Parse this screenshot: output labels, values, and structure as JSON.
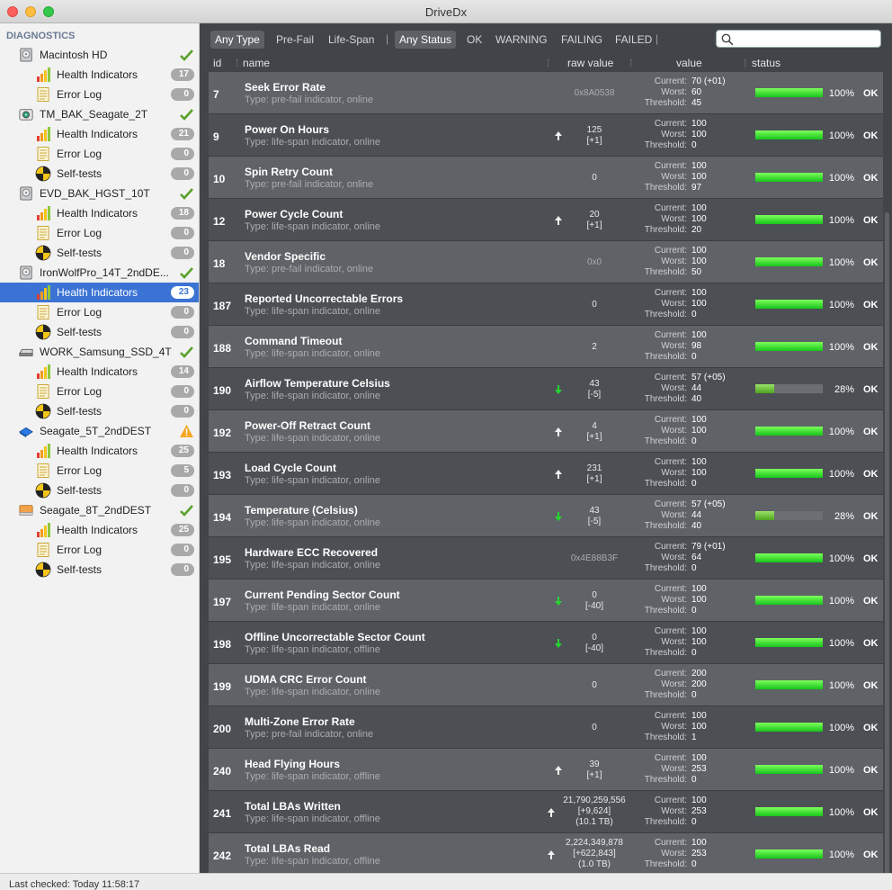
{
  "window": {
    "title": "DriveDx"
  },
  "sidebar": {
    "title": "DIAGNOSTICS",
    "drives": [
      {
        "name": "Macintosh HD",
        "icon": "hdd-icon",
        "status": "ok",
        "items": [
          {
            "label": "Health Indicators",
            "count": "17",
            "icon": "bar-chart-icon"
          },
          {
            "label": "Error Log",
            "count": "0",
            "icon": "log-icon"
          }
        ]
      },
      {
        "name": "TM_BAK_Seagate_2T",
        "icon": "external-drive-icon",
        "status": "ok",
        "items": [
          {
            "label": "Health Indicators",
            "count": "21",
            "icon": "bar-chart-icon"
          },
          {
            "label": "Error Log",
            "count": "0",
            "icon": "log-icon"
          },
          {
            "label": "Self-tests",
            "count": "0",
            "icon": "selftest-icon"
          }
        ]
      },
      {
        "name": "EVD_BAK_HGST_10T",
        "icon": "hdd-icon",
        "status": "ok",
        "items": [
          {
            "label": "Health Indicators",
            "count": "18",
            "icon": "bar-chart-icon"
          },
          {
            "label": "Error Log",
            "count": "0",
            "icon": "log-icon"
          },
          {
            "label": "Self-tests",
            "count": "0",
            "icon": "selftest-icon"
          }
        ]
      },
      {
        "name": "IronWolfPro_14T_2ndDE...",
        "icon": "hdd-icon",
        "status": "ok",
        "items": [
          {
            "label": "Health Indicators",
            "count": "23",
            "icon": "bar-chart-icon",
            "selected": true
          },
          {
            "label": "Error Log",
            "count": "0",
            "icon": "log-icon"
          },
          {
            "label": "Self-tests",
            "count": "0",
            "icon": "selftest-icon"
          }
        ]
      },
      {
        "name": "WORK_Samsung_SSD_4T",
        "icon": "ssd-icon",
        "status": "ok",
        "items": [
          {
            "label": "Health Indicators",
            "count": "14",
            "icon": "bar-chart-icon"
          },
          {
            "label": "Error Log",
            "count": "0",
            "icon": "log-icon"
          },
          {
            "label": "Self-tests",
            "count": "0",
            "icon": "selftest-icon"
          }
        ]
      },
      {
        "name": "Seagate_5T_2ndDEST",
        "icon": "blue-drive-icon",
        "status": "warning",
        "items": [
          {
            "label": "Health Indicators",
            "count": "25",
            "icon": "bar-chart-icon"
          },
          {
            "label": "Error Log",
            "count": "5",
            "icon": "log-icon"
          },
          {
            "label": "Self-tests",
            "count": "0",
            "icon": "selftest-icon"
          }
        ]
      },
      {
        "name": "Seagate_8T_2ndDEST",
        "icon": "orange-drive-icon",
        "status": "ok",
        "items": [
          {
            "label": "Health Indicators",
            "count": "25",
            "icon": "bar-chart-icon"
          },
          {
            "label": "Error Log",
            "count": "0",
            "icon": "log-icon"
          },
          {
            "label": "Self-tests",
            "count": "0",
            "icon": "selftest-icon"
          }
        ]
      }
    ]
  },
  "filters": {
    "type": [
      {
        "label": "Any Type",
        "active": true
      },
      {
        "label": "Pre-Fail",
        "active": false
      },
      {
        "label": "Life-Span",
        "active": false
      }
    ],
    "status": [
      {
        "label": "Any Status",
        "active": true
      },
      {
        "label": "OK",
        "active": false
      },
      {
        "label": "WARNING",
        "active": false
      },
      {
        "label": "FAILING",
        "active": false
      },
      {
        "label": "FAILED",
        "active": false
      }
    ],
    "separator": "|",
    "search": {
      "value": "",
      "placeholder": ""
    }
  },
  "table": {
    "columns": {
      "id": "id",
      "name": "name",
      "raw": "raw value",
      "value": "value",
      "status": "status"
    },
    "labels": {
      "current": "Current:",
      "worst": "Worst:",
      "threshold": "Threshold:"
    },
    "rows": [
      {
        "id": "7",
        "name": "Seek Error Rate",
        "type": "Type: pre-fail indicator, online",
        "raw": [
          "0x8A0538"
        ],
        "hex": true,
        "trend": "none",
        "current": "70 (+01)",
        "worst": "60",
        "threshold": "45",
        "pct": 100,
        "pct_label": "100%",
        "status": "OK"
      },
      {
        "id": "9",
        "name": "Power On Hours",
        "type": "Type: life-span indicator, online",
        "raw": [
          "125",
          "[+1]"
        ],
        "trend": "up",
        "current": "100",
        "worst": "100",
        "threshold": "0",
        "pct": 100,
        "pct_label": "100%",
        "status": "OK"
      },
      {
        "id": "10",
        "name": "Spin Retry Count",
        "type": "Type: pre-fail indicator, online",
        "raw": [
          "0"
        ],
        "trend": "none",
        "current": "100",
        "worst": "100",
        "threshold": "97",
        "pct": 100,
        "pct_label": "100%",
        "status": "OK"
      },
      {
        "id": "12",
        "name": "Power Cycle Count",
        "type": "Type: life-span indicator, online",
        "raw": [
          "20",
          "[+1]"
        ],
        "trend": "up",
        "current": "100",
        "worst": "100",
        "threshold": "20",
        "pct": 100,
        "pct_label": "100%",
        "status": "OK"
      },
      {
        "id": "18",
        "name": "Vendor Specific",
        "type": "Type: pre-fail indicator, online",
        "raw": [
          "0x0"
        ],
        "hex": true,
        "trend": "none",
        "current": "100",
        "worst": "100",
        "threshold": "50",
        "pct": 100,
        "pct_label": "100%",
        "status": "OK"
      },
      {
        "id": "187",
        "name": "Reported Uncorrectable Errors",
        "type": "Type: life-span indicator, online",
        "raw": [
          "0"
        ],
        "trend": "none",
        "current": "100",
        "worst": "100",
        "threshold": "0",
        "pct": 100,
        "pct_label": "100%",
        "status": "OK"
      },
      {
        "id": "188",
        "name": "Command Timeout",
        "type": "Type: life-span indicator, online",
        "raw": [
          "2"
        ],
        "trend": "none",
        "current": "100",
        "worst": "98",
        "threshold": "0",
        "pct": 100,
        "pct_label": "100%",
        "status": "OK"
      },
      {
        "id": "190",
        "name": "Airflow Temperature Celsius",
        "type": "Type: life-span indicator, online",
        "raw": [
          "43",
          "[-5]"
        ],
        "trend": "down",
        "current": "57 (+05)",
        "worst": "44",
        "threshold": "40",
        "pct": 28,
        "pct_label": "28%",
        "status": "OK"
      },
      {
        "id": "192",
        "name": "Power-Off Retract Count",
        "type": "Type: life-span indicator, online",
        "raw": [
          "4",
          "[+1]"
        ],
        "trend": "up",
        "current": "100",
        "worst": "100",
        "threshold": "0",
        "pct": 100,
        "pct_label": "100%",
        "status": "OK"
      },
      {
        "id": "193",
        "name": "Load Cycle Count",
        "type": "Type: life-span indicator, online",
        "raw": [
          "231",
          "[+1]"
        ],
        "trend": "up",
        "current": "100",
        "worst": "100",
        "threshold": "0",
        "pct": 100,
        "pct_label": "100%",
        "status": "OK"
      },
      {
        "id": "194",
        "name": "Temperature (Celsius)",
        "type": "Type: life-span indicator, online",
        "raw": [
          "43",
          "[-5]"
        ],
        "trend": "down",
        "current": "57 (+05)",
        "worst": "44",
        "threshold": "40",
        "pct": 28,
        "pct_label": "28%",
        "status": "OK"
      },
      {
        "id": "195",
        "name": "Hardware ECC Recovered",
        "type": "Type: life-span indicator, online",
        "raw": [
          "0x4E88B3F"
        ],
        "hex": true,
        "trend": "none",
        "current": "79 (+01)",
        "worst": "64",
        "threshold": "0",
        "pct": 100,
        "pct_label": "100%",
        "status": "OK"
      },
      {
        "id": "197",
        "name": "Current Pending Sector Count",
        "type": "Type: life-span indicator, online",
        "raw": [
          "0",
          "[-40]"
        ],
        "trend": "down",
        "current": "100",
        "worst": "100",
        "threshold": "0",
        "pct": 100,
        "pct_label": "100%",
        "status": "OK"
      },
      {
        "id": "198",
        "name": "Offline Uncorrectable Sector Count",
        "type": "Type: life-span indicator, offline",
        "raw": [
          "0",
          "[-40]"
        ],
        "trend": "down",
        "current": "100",
        "worst": "100",
        "threshold": "0",
        "pct": 100,
        "pct_label": "100%",
        "status": "OK"
      },
      {
        "id": "199",
        "name": "UDMA CRC Error Count",
        "type": "Type: life-span indicator, online",
        "raw": [
          "0"
        ],
        "trend": "none",
        "current": "200",
        "worst": "200",
        "threshold": "0",
        "pct": 100,
        "pct_label": "100%",
        "status": "OK"
      },
      {
        "id": "200",
        "name": "Multi-Zone Error Rate",
        "type": "Type: pre-fail indicator, online",
        "raw": [
          "0"
        ],
        "trend": "none",
        "current": "100",
        "worst": "100",
        "threshold": "1",
        "pct": 100,
        "pct_label": "100%",
        "status": "OK"
      },
      {
        "id": "240",
        "name": "Head Flying Hours",
        "type": "Type: life-span indicator, offline",
        "raw": [
          "39",
          "[+1]"
        ],
        "trend": "up",
        "current": "100",
        "worst": "253",
        "threshold": "0",
        "pct": 100,
        "pct_label": "100%",
        "status": "OK"
      },
      {
        "id": "241",
        "name": "Total LBAs Written",
        "type": "Type: life-span indicator, offline",
        "raw": [
          "21,790,259,556",
          "[+9,624]",
          "(10.1 TB)"
        ],
        "trend": "up",
        "current": "100",
        "worst": "253",
        "threshold": "0",
        "pct": 100,
        "pct_label": "100%",
        "status": "OK"
      },
      {
        "id": "242",
        "name": "Total LBAs Read",
        "type": "Type: life-span indicator, offline",
        "raw": [
          "2,224,349,878",
          "[+622,843]",
          "(1.0 TB)"
        ],
        "trend": "up",
        "current": "100",
        "worst": "253",
        "threshold": "0",
        "pct": 100,
        "pct_label": "100%",
        "status": "OK"
      }
    ]
  },
  "statusbar": {
    "text": "Last checked: Today 11:58:17"
  },
  "colors": {
    "selection": "#3b73d4",
    "ok_green": "#17c41b",
    "warning": "#f5a623",
    "panel": "#414549"
  }
}
